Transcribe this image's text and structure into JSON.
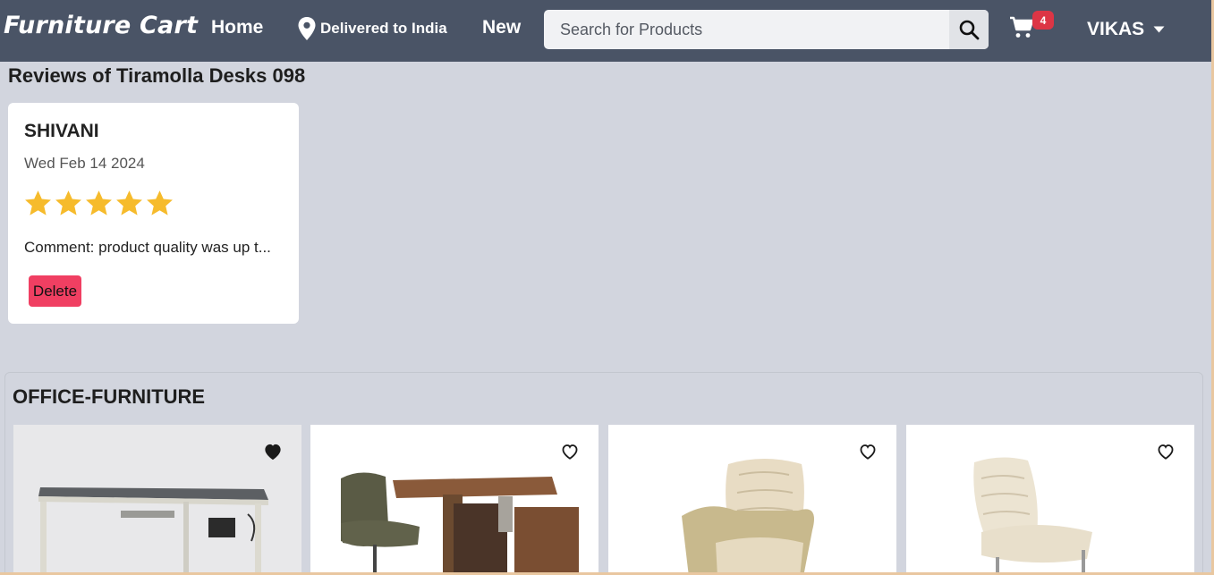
{
  "navbar": {
    "brand": "Furniture Cart",
    "home": "Home",
    "delivery": "Delivered to India",
    "new": "New",
    "search_placeholder": "Search for Products",
    "cart_count": "4",
    "user": "VIKAS"
  },
  "reviews": {
    "title": "Reviews of Tiramolla Desks 098",
    "items": [
      {
        "name": "SHIVANI",
        "date": "Wed Feb 14 2024",
        "rating": 5,
        "comment": "Comment: product quality was up t...",
        "delete_label": "Delete"
      }
    ]
  },
  "category": {
    "title": "OFFICE-FURNITURE",
    "products": [
      {
        "image": "standing-desk",
        "wishlisted": true
      },
      {
        "image": "chair-and-desk-set",
        "wishlisted": false
      },
      {
        "image": "cream-armchair",
        "wishlisted": false
      },
      {
        "image": "cream-lounge-chair",
        "wishlisted": false
      }
    ]
  },
  "colors": {
    "navbar": "#4a5466",
    "page_bg": "#d2d5de",
    "badge": "#dc3545",
    "delete_button": "#f03f62",
    "star": "#f6bb2c"
  }
}
